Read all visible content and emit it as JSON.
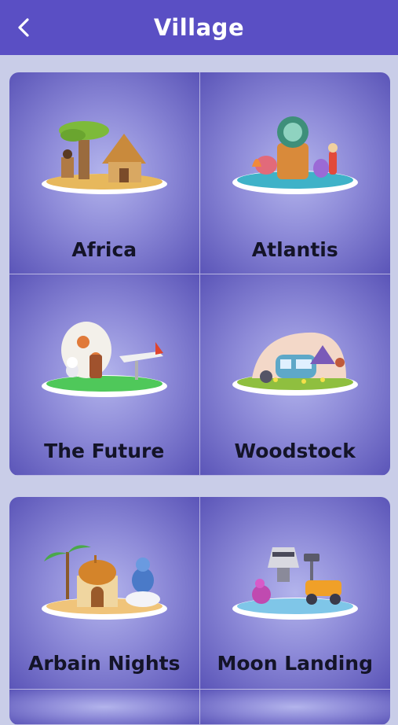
{
  "header": {
    "title": "Village",
    "back_icon": "chevron-left-icon"
  },
  "sections": [
    {
      "tiles": [
        {
          "label": "Africa"
        },
        {
          "label": "Atlantis"
        },
        {
          "label": "The Future"
        },
        {
          "label": "Woodstock"
        }
      ]
    },
    {
      "tiles": [
        {
          "label": "Arbain Nights"
        },
        {
          "label": "Moon Landing"
        }
      ]
    }
  ],
  "colors": {
    "header": "#5a4fc4",
    "background": "#c9cde8",
    "tile": "#8d8ad8",
    "label": "#141428"
  }
}
